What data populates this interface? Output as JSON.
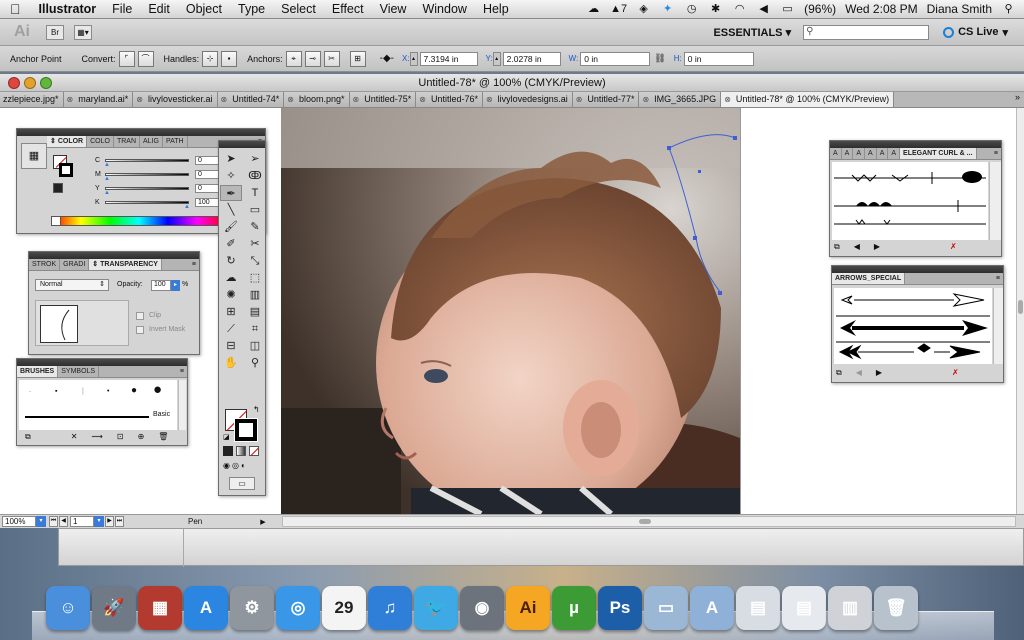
{
  "menubar": {
    "apple": "",
    "app_name": "Illustrator",
    "items": [
      "File",
      "Edit",
      "Object",
      "Type",
      "Select",
      "Effect",
      "View",
      "Window",
      "Help"
    ],
    "status_adobe_count": "7",
    "battery": "(96%)",
    "clock": "Wed 2:08 PM",
    "user": "Diana Smith"
  },
  "appbar": {
    "logo": "Ai",
    "bridge": "Br",
    "workspace": "ESSENTIALS",
    "search_placeholder": "",
    "cslive": "CS Live"
  },
  "controlbar": {
    "title": "Anchor Point",
    "convert": "Convert:",
    "handles": "Handles:",
    "anchors": "Anchors:",
    "x_label": "X:",
    "x_value": "7.3194 in",
    "y_label": "Y:",
    "y_value": "2.0278 in",
    "w_label": "W:",
    "w_value": "0 in",
    "h_label": "H:",
    "h_value": "0 in"
  },
  "document": {
    "title": "Untitled-78* @ 100% (CMYK/Preview)",
    "tabs": [
      {
        "label": "zzlepiece.jpg*",
        "active": false
      },
      {
        "label": "maryland.ai*",
        "active": false
      },
      {
        "label": "livylovesticker.ai",
        "active": false
      },
      {
        "label": "Untitled-74*",
        "active": false
      },
      {
        "label": "bloom.png*",
        "active": false
      },
      {
        "label": "Untitled-75*",
        "active": false
      },
      {
        "label": "Untitled-76*",
        "active": false
      },
      {
        "label": "livylovedesigns.ai",
        "active": false
      },
      {
        "label": "Untitled-77*",
        "active": false
      },
      {
        "label": "IMG_3665.JPG",
        "active": false
      },
      {
        "label": "Untitled-78* @ 100% (CMYK/Preview)",
        "active": true
      }
    ],
    "tab_more": "»"
  },
  "statusbar": {
    "zoom": "100%",
    "page": "1",
    "tool": "Pen"
  },
  "color_panel": {
    "tabs": [
      "COLOR",
      "COLO",
      "TRAN",
      "ALIG",
      "PATH"
    ],
    "channels": [
      {
        "label": "C",
        "value": "0",
        "fill": 0
      },
      {
        "label": "M",
        "value": "0",
        "fill": 0
      },
      {
        "label": "Y",
        "value": "0",
        "fill": 0
      },
      {
        "label": "K",
        "value": "100",
        "fill": 1
      }
    ],
    "percent": "%"
  },
  "transparency_panel": {
    "tabs": [
      "STROK",
      "GRADI",
      "TRANSPARENCY"
    ],
    "blend_mode": "Normal",
    "opacity_label": "Opacity:",
    "opacity_value": "100",
    "percent": "%",
    "clip": "Clip",
    "invert_mask": "Invert Mask"
  },
  "brushes_panel": {
    "tabs": [
      "BRUSHES",
      "SYMBOLS"
    ],
    "basic_label": "Basic"
  },
  "curl_panel": {
    "tab": "ELEGANT CURL & ..."
  },
  "arrows_panel": {
    "tab": "ARROWS_SPECIAL"
  },
  "tools": [
    "select-arrow",
    "direct-select",
    "magic-wand",
    "lasso",
    "pen",
    "type",
    "line",
    "rectangle",
    "paintbrush",
    "pencil",
    "blob-brush",
    "eraser",
    "rotate",
    "scale",
    "warp",
    "free-transform",
    "symbol-sprayer",
    "column-graph",
    "mesh",
    "gradient",
    "eyedropper",
    "blend",
    "slice",
    "artboard",
    "hand",
    "zoom"
  ],
  "dock": [
    {
      "name": "finder",
      "color": "#4a8fdb",
      "glyph": "☺"
    },
    {
      "name": "launchpad",
      "color": "#707a86",
      "glyph": "🚀"
    },
    {
      "name": "photo-booth",
      "color": "#b33a2e",
      "glyph": "▦"
    },
    {
      "name": "app-store",
      "color": "#2a86e0",
      "glyph": "A"
    },
    {
      "name": "system-preferences",
      "color": "#8f969e",
      "glyph": "⚙"
    },
    {
      "name": "safari",
      "color": "#3a96e6",
      "glyph": "◎"
    },
    {
      "name": "calendar",
      "color": "#f4f4f4",
      "glyph": "29"
    },
    {
      "name": "itunes",
      "color": "#2f7ed8",
      "glyph": "♫"
    },
    {
      "name": "twitter",
      "color": "#3fa9e6",
      "glyph": "🐦"
    },
    {
      "name": "facetime",
      "color": "#6c737c",
      "glyph": "◉"
    },
    {
      "name": "illustrator",
      "color": "#f79a1b",
      "glyph": "Ai"
    },
    {
      "name": "utorrent",
      "color": "#3d9b35",
      "glyph": "µ"
    },
    {
      "name": "photoshop",
      "color": "#1d5ea8",
      "glyph": "Ps"
    },
    {
      "name": "folder",
      "color": "#9ab7d6",
      "glyph": "▭"
    },
    {
      "name": "applications-folder",
      "color": "#8fb1d8",
      "glyph": "A"
    },
    {
      "name": "screenshot-1",
      "color": "#d8dde4",
      "glyph": "▤"
    },
    {
      "name": "screenshot-2",
      "color": "#e6e9ed",
      "glyph": "▤"
    },
    {
      "name": "document-stack",
      "color": "#cfd3d8",
      "glyph": "▥"
    },
    {
      "name": "trash",
      "color": "#b8c2cc",
      "glyph": "🗑"
    }
  ]
}
